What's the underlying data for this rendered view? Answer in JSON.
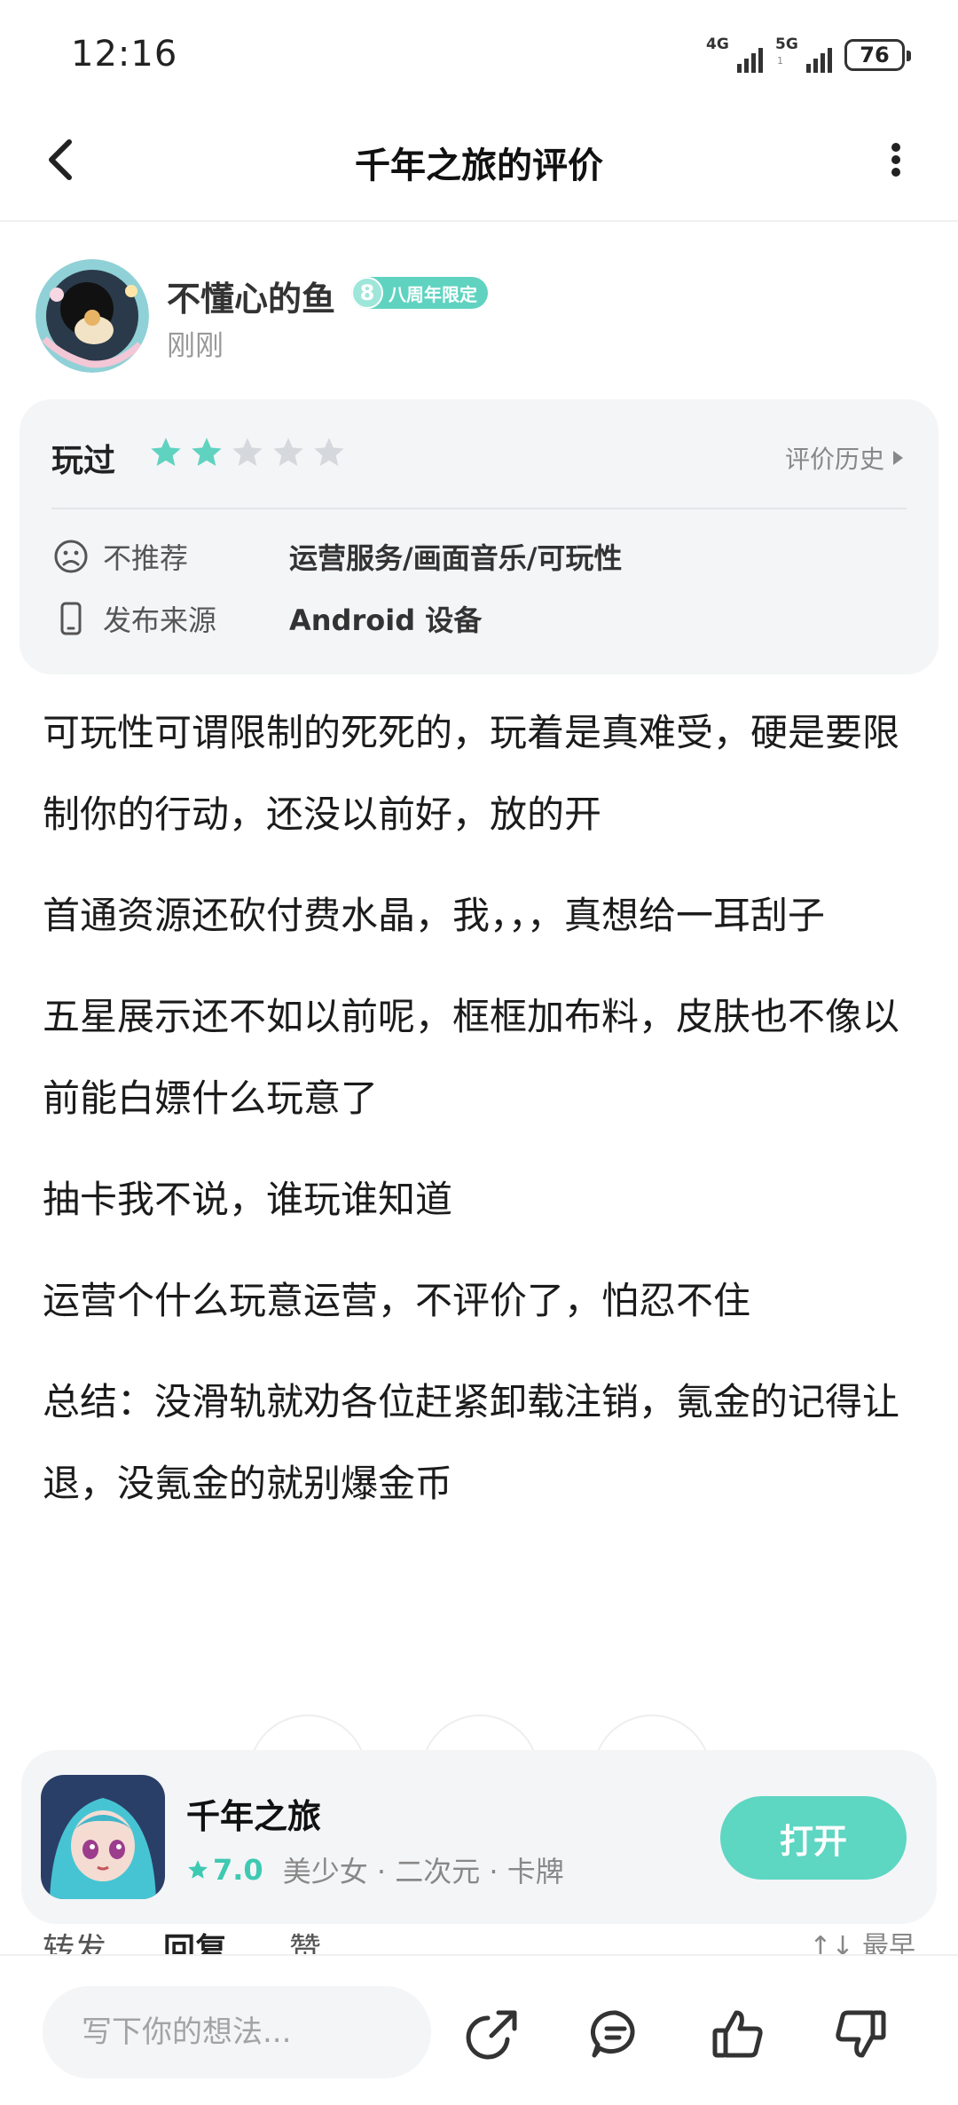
{
  "status_bar": {
    "time": "12:16",
    "network_1": "4G",
    "network_2": "5G",
    "network_2_sub": "1",
    "battery": "76"
  },
  "nav": {
    "title": "千年之旅的评价"
  },
  "user": {
    "name": "不懂心的鱼",
    "badge_number": "8",
    "badge_text": "八周年限定",
    "time": "刚刚"
  },
  "review_card": {
    "played_label": "玩过",
    "rating": 2,
    "rating_max": 5,
    "history_label": "评价历史",
    "rows": [
      {
        "icon": "frown-face-icon",
        "label": "不推荐",
        "value": "运营服务/画面音乐/可玩性"
      },
      {
        "icon": "phone-icon",
        "label": "发布来源",
        "value": "Android 设备"
      }
    ]
  },
  "review_paragraphs": [
    "可玩性可谓限制的死死的，玩着是真难受，硬是要限制你的行动，还没以前好，放的开",
    "首通资源还砍付费水晶，我，，，真想给一耳刮子",
    "五星展示还不如以前呢，框框加布料，皮肤也不像以前能白嫖什么玩意了",
    "抽卡我不说，谁玩谁知道",
    "运营个什么玩意运营，不评价了，怕忍不住",
    "总结：没滑轨就劝各位赶紧卸载注销，氪金的记得让退，没氪金的就别爆金币"
  ],
  "game_card": {
    "name": "千年之旅",
    "score": "7.0",
    "tags": "美少女 · 二次元 · 卡牌",
    "open_label": "打开"
  },
  "tabs_peek": {
    "repost": "转发",
    "reply": "回复",
    "like": "赞",
    "sort": "↑↓ 最早"
  },
  "bottom_bar": {
    "input_placeholder": "写下你的想法..."
  },
  "colors": {
    "accent": "#5dd6c2",
    "star_active": "#5fd3c0",
    "star_inactive": "#d5d8dc"
  }
}
